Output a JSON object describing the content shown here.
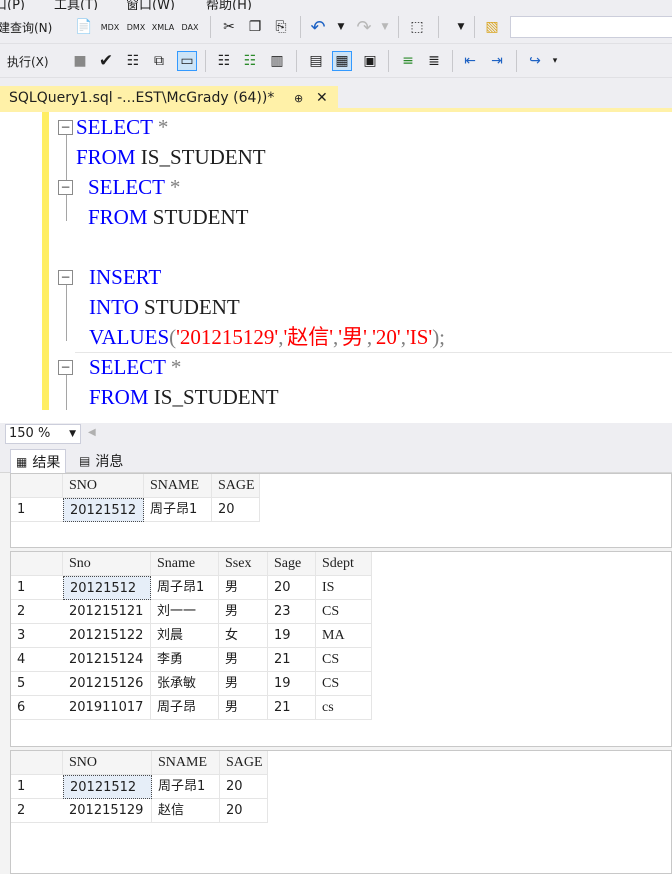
{
  "menu": {
    "items": [
      "口(P)",
      "工具(T)",
      "窗口(W)",
      "帮助(H)"
    ]
  },
  "toolbar": {
    "new_query_label": "建查询(N)",
    "mdx_label": "MDX",
    "dmx_label": "DMX",
    "xmla_label": "XMLA",
    "dax_label": "DAX"
  },
  "toolbar2": {
    "execute_label": "执行(X)"
  },
  "editor": {
    "tab_title": "SQLQuery1.sql -...EST\\McGrady (64))*",
    "lines": [
      {
        "kw": "SELECT",
        "rest": " *"
      },
      {
        "kw": "FROM",
        "rest": " IS_STUDENT"
      },
      {
        "kw": "SELECT",
        "rest": " *"
      },
      {
        "kw": "FROM",
        "rest": " STUDENT"
      },
      {
        "kw": "INSERT",
        "rest": ""
      },
      {
        "kw": "INTO",
        "rest": " STUDENT"
      },
      {
        "kw": "VALUES",
        "values": [
          "'201215129'",
          "'赵信'",
          "'男'",
          "'20'",
          "'IS'"
        ]
      },
      {
        "kw": "SELECT",
        "rest": " *"
      },
      {
        "kw": "FROM",
        "rest": " IS_STUDENT"
      }
    ]
  },
  "zoom": {
    "value": "150 %"
  },
  "result_tabs": {
    "results": "结果",
    "messages": "消息"
  },
  "grid1": {
    "columns": [
      "SNO",
      "SNAME",
      "SAGE"
    ],
    "rows": [
      {
        "n": "1",
        "cells": [
          "20121512",
          "周子昂1",
          "20"
        ]
      }
    ]
  },
  "grid2": {
    "columns": [
      "Sno",
      "Sname",
      "Ssex",
      "Sage",
      "Sdept"
    ],
    "rows": [
      {
        "n": "1",
        "cells": [
          "20121512",
          "周子昂1",
          "男",
          "20",
          "IS"
        ]
      },
      {
        "n": "2",
        "cells": [
          "201215121",
          "刘一一",
          "男",
          "23",
          "CS"
        ]
      },
      {
        "n": "3",
        "cells": [
          "201215122",
          "刘晨",
          "女",
          "19",
          "MA"
        ]
      },
      {
        "n": "4",
        "cells": [
          "201215124",
          "李勇",
          "男",
          "21",
          "CS"
        ]
      },
      {
        "n": "5",
        "cells": [
          "201215126",
          "张承敏",
          "男",
          "19",
          "CS"
        ]
      },
      {
        "n": "6",
        "cells": [
          "201911017",
          "周子昂",
          "男",
          "21",
          "cs"
        ]
      }
    ]
  },
  "grid3": {
    "columns": [
      "SNO",
      "SNAME",
      "SAGE"
    ],
    "rows": [
      {
        "n": "1",
        "cells": [
          "20121512",
          "周子昂1",
          "20"
        ]
      },
      {
        "n": "2",
        "cells": [
          "201215129",
          "赵信",
          "20"
        ]
      }
    ]
  }
}
